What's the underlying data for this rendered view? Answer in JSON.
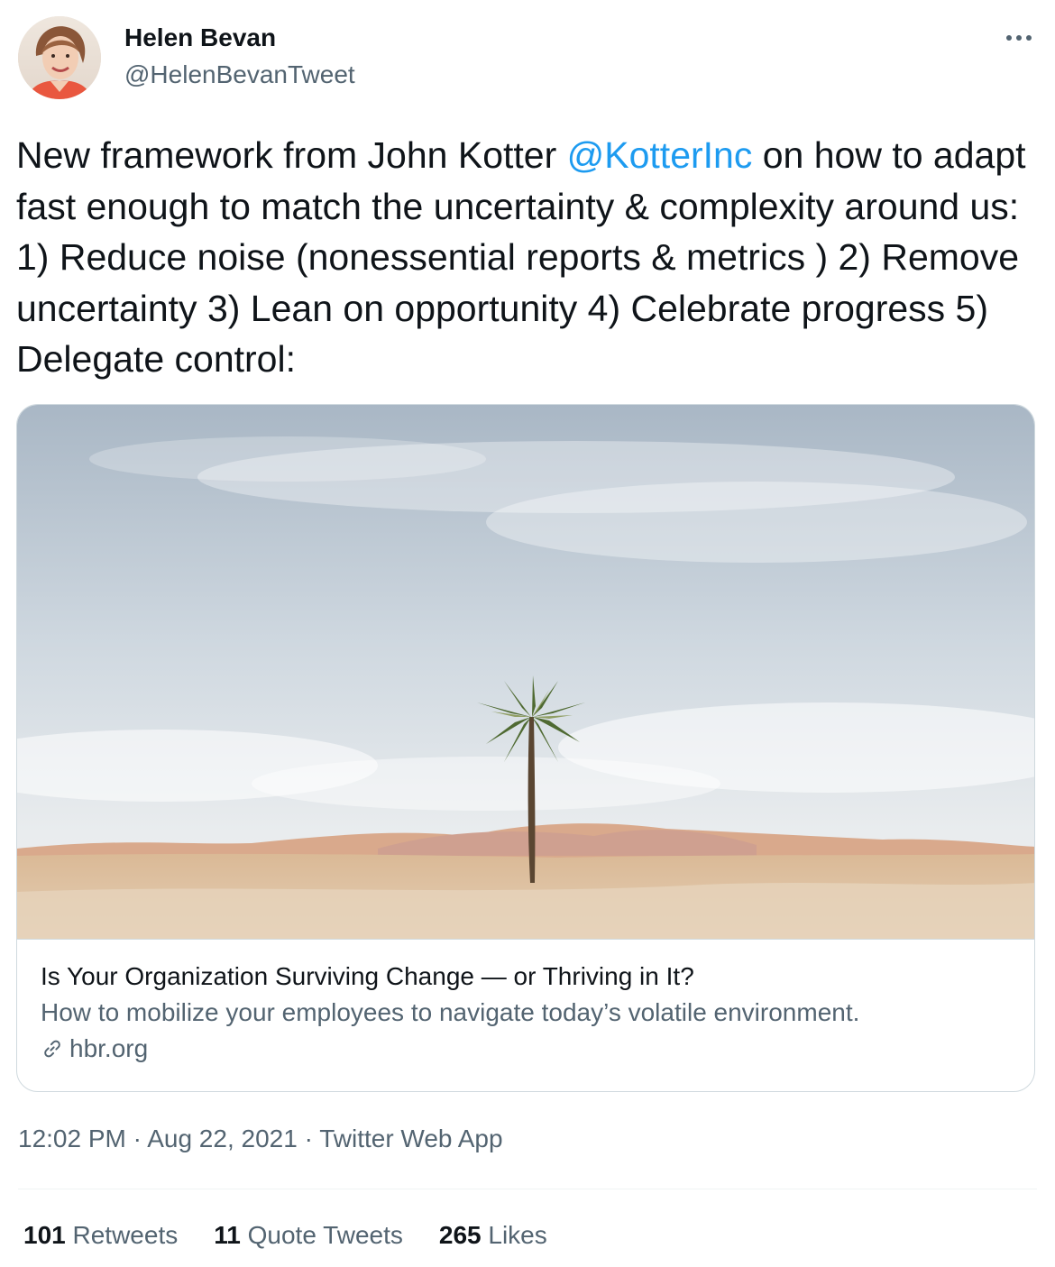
{
  "author": {
    "name": "Helen Bevan",
    "handle": "@HelenBevanTweet"
  },
  "tweet": {
    "text_before": "New framework from John Kotter ",
    "mention": "@KotterInc",
    "text_after": " on how to adapt fast enough to match the uncertainty & complexity around us: 1) Reduce noise (nonessential reports & metrics ) 2) Remove uncertainty 3) Lean on opportunity 4) Celebrate progress 5) Delegate control:"
  },
  "card": {
    "title": "Is Your Organization Surviving Change — or Thriving in It?",
    "description": "How to mobilize your employees to navigate today’s volatile environment.",
    "domain": "hbr.org"
  },
  "meta": {
    "time": "12:02 PM",
    "separator": " · ",
    "date": "Aug 22, 2021",
    "source": "Twitter Web App"
  },
  "stats": {
    "retweets": {
      "count": "101",
      "label": "Retweets"
    },
    "quote_tweets": {
      "count": "11",
      "label": "Quote Tweets"
    },
    "likes": {
      "count": "265",
      "label": "Likes"
    }
  },
  "icons": {
    "more": "more-horizontal-icon",
    "link": "link-icon"
  },
  "colors": {
    "accent": "#1d9bf0",
    "secondary_text": "#536471",
    "border": "#cfd9de"
  }
}
